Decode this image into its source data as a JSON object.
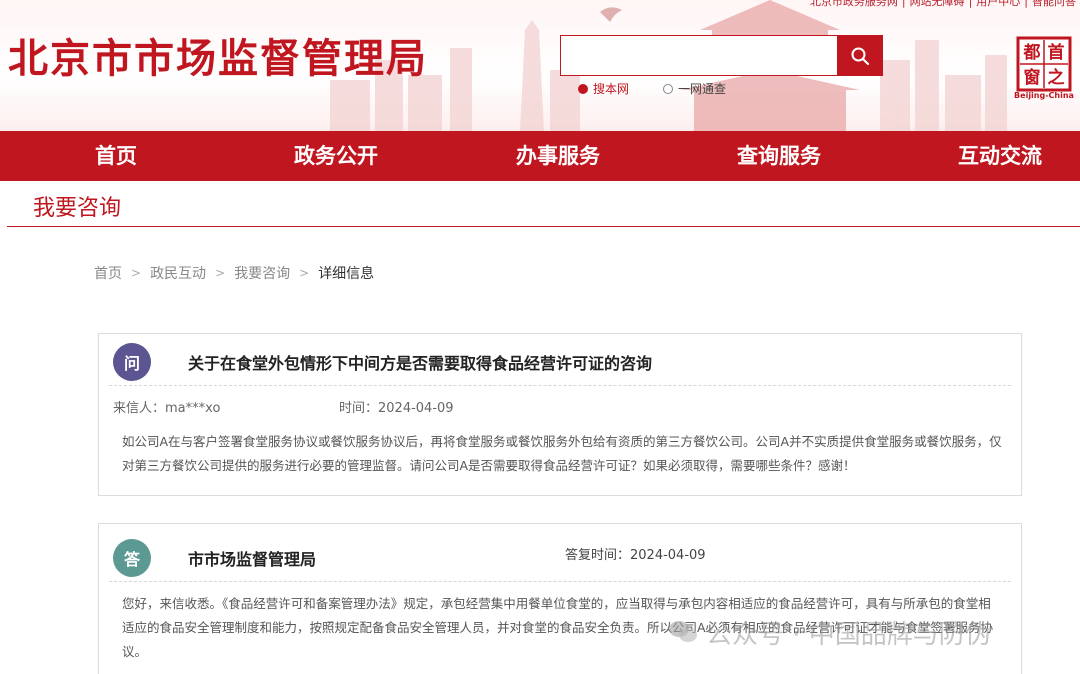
{
  "header": {
    "top_links": [
      "北京市政务服务网",
      "网站无障碍",
      "用户中心",
      "智能问答"
    ],
    "site_title": "北京市市场监督管理局",
    "search": {
      "placeholder": "",
      "scopes": [
        {
          "label": "搜本网",
          "selected": true
        },
        {
          "label": "一网通查",
          "selected": false
        }
      ]
    },
    "logo": {
      "chars": [
        "首",
        "都",
        "之",
        "窗"
      ],
      "caption": "Beijing-China"
    }
  },
  "nav": {
    "items": [
      "首页",
      "政务公开",
      "办事服务",
      "查询服务",
      "互动交流"
    ]
  },
  "page_heading": "我要咨询",
  "breadcrumb": [
    "首页",
    "政民互动",
    "我要咨询",
    "详细信息"
  ],
  "question": {
    "badge": "问",
    "title": "关于在食堂外包情形下中间方是否需要取得食品经营许可证的咨询",
    "sender_label": "来信人：",
    "sender": "ma***xo",
    "time_label": "时间：",
    "time": "2024-04-09",
    "body": "如公司A在与客户签署食堂服务协议或餐饮服务协议后，再将食堂服务或餐饮服务外包给有资质的第三方餐饮公司。公司A并不实质提供食堂服务或餐饮服务，仅对第三方餐饮公司提供的服务进行必要的管理监督。请问公司A是否需要取得食品经营许可证？如果必须取得，需要哪些条件？感谢！"
  },
  "answer": {
    "badge": "答",
    "org": "市市场监督管理局",
    "time_label": "答复时间：",
    "time": "2024-04-09",
    "body": "您好，来信收悉。《食品经营许可和备案管理办法》规定，承包经营集中用餐单位食堂的，应当取得与承包内容相适应的食品经营许可，具有与所承包的食堂相适应的食品安全管理制度和能力，按照规定配备食品安全管理人员，并对食堂的食品安全负责。所以公司A必须有相应的食品经营许可证才能与食堂签署服务协议。"
  },
  "watermark": "公众号 · 中国品牌与防伪",
  "colors": {
    "brand_red": "#c0161f",
    "question_badge": "#5b5592",
    "answer_badge": "#5d9993"
  }
}
